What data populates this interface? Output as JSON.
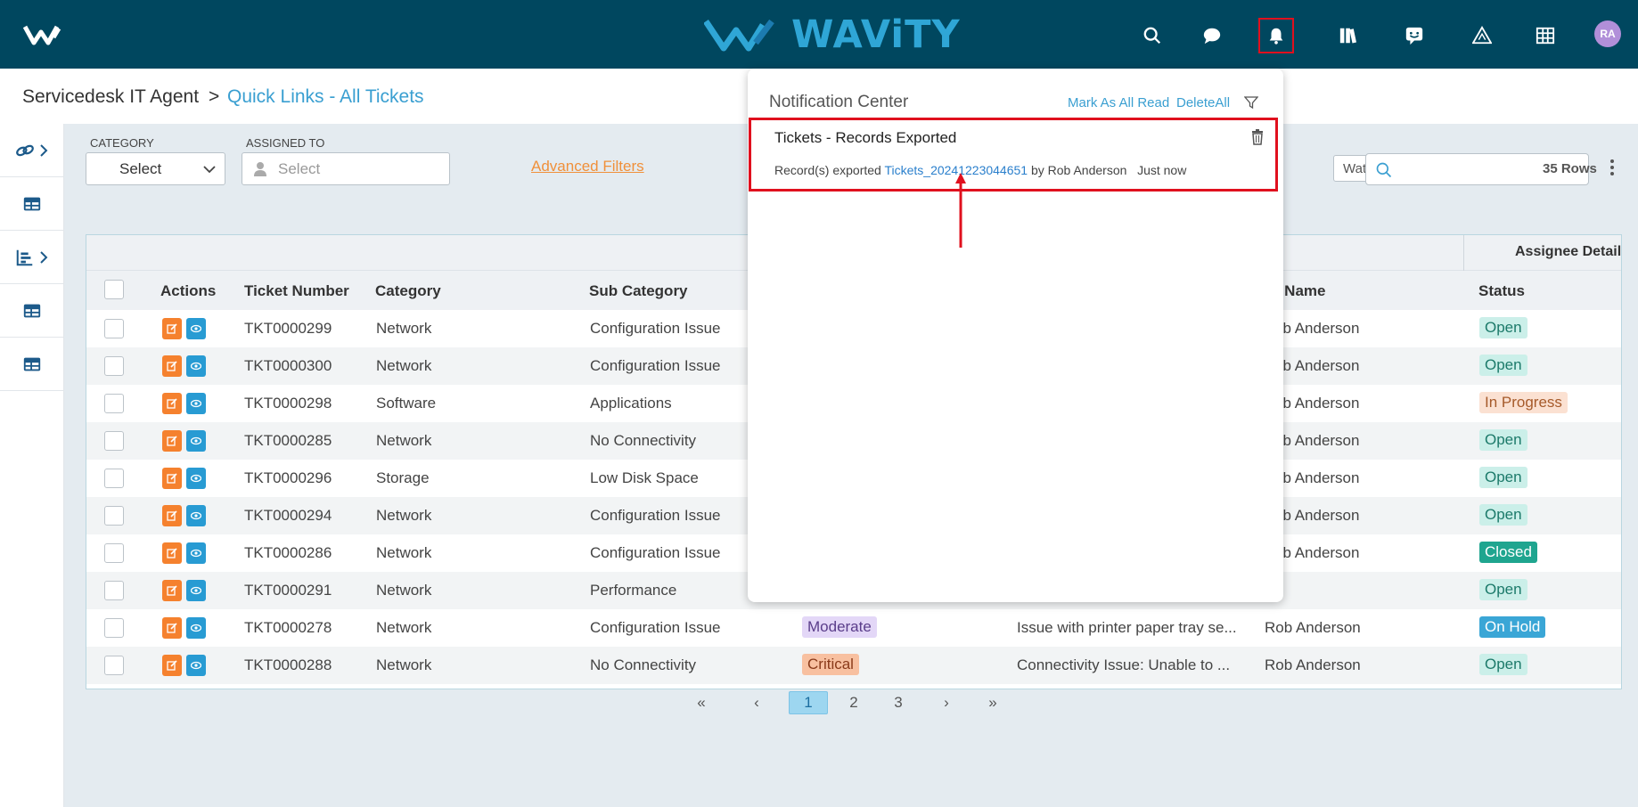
{
  "header": {
    "brand": "WAViTY",
    "avatar_initials": "RA",
    "icons": [
      "search-icon",
      "chat-icon",
      "bell-icon",
      "library-icon",
      "feedback-icon",
      "warning-icon",
      "grid-icon"
    ]
  },
  "breadcrumb": {
    "root": "Servicedesk IT Agent",
    "separator": ">",
    "current": "Quick Links - All Tickets"
  },
  "filters": {
    "category_label": "CATEGORY",
    "category_value": "Select",
    "assigned_label": "ASSIGNED TO",
    "assigned_placeholder": "Select",
    "advanced": "Advanced Filters",
    "watching": "Watching",
    "rows_count": "35 Rows"
  },
  "table": {
    "group_header": "Assignee Details",
    "columns": {
      "actions": "Actions",
      "ticket_number": "Ticket Number",
      "category": "Category",
      "sub_category": "Sub Category",
      "full_name": "ll Name",
      "status": "Status"
    },
    "rows": [
      {
        "ticket": "TKT0000299",
        "category": "Network",
        "sub": "Configuration Issue",
        "priority": "",
        "subject": "",
        "name": "ob Anderson",
        "status": "Open"
      },
      {
        "ticket": "TKT0000300",
        "category": "Network",
        "sub": "Configuration Issue",
        "priority": "",
        "subject": "",
        "name": "ob Anderson",
        "status": "Open"
      },
      {
        "ticket": "TKT0000298",
        "category": "Software",
        "sub": "Applications",
        "priority": "",
        "subject": "",
        "name": "ob Anderson",
        "status": "In Progress"
      },
      {
        "ticket": "TKT0000285",
        "category": "Network",
        "sub": "No Connectivity",
        "priority": "",
        "subject": "",
        "name": "ob Anderson",
        "status": "Open"
      },
      {
        "ticket": "TKT0000296",
        "category": "Storage",
        "sub": "Low Disk Space",
        "priority": "",
        "subject": "",
        "name": "ob Anderson",
        "status": "Open"
      },
      {
        "ticket": "TKT0000294",
        "category": "Network",
        "sub": "Configuration Issue",
        "priority": "",
        "subject": "",
        "name": "ob Anderson",
        "status": "Open"
      },
      {
        "ticket": "TKT0000286",
        "category": "Network",
        "sub": "Configuration Issue",
        "priority": "",
        "subject": "",
        "name": "ob Anderson",
        "status": "Closed"
      },
      {
        "ticket": "TKT0000291",
        "category": "Network",
        "sub": "Performance",
        "priority": "",
        "subject": "",
        "name": "",
        "status": "Open"
      },
      {
        "ticket": "TKT0000278",
        "category": "Network",
        "sub": "Configuration Issue",
        "priority": "Moderate",
        "subject": "Issue with printer paper tray se...",
        "name": "Rob Anderson",
        "status": "On Hold"
      },
      {
        "ticket": "TKT0000288",
        "category": "Network",
        "sub": "No Connectivity",
        "priority": "Critical",
        "subject": "Connectivity Issue: Unable to ...",
        "name": "Rob Anderson",
        "status": "Open"
      }
    ]
  },
  "pagination": {
    "first": "«",
    "prev": "‹",
    "pages": [
      "1",
      "2",
      "3"
    ],
    "next": "›",
    "last": "»"
  },
  "notification_center": {
    "title": "Notification Center",
    "mark_all_read": "Mark As All Read",
    "delete_all": "DeleteAll",
    "item": {
      "title": "Tickets - Records Exported",
      "prefix": "Record(s)  exported",
      "file_link": "Tickets_20241223044651",
      "by": "by  Rob Anderson",
      "time": "Just now"
    }
  },
  "colors": {
    "header_bg": "#00475f",
    "accent": "#3a9fd1",
    "edit_button": "#f5812e",
    "view_button": "#289bd3",
    "highlight": "#e0101e"
  }
}
